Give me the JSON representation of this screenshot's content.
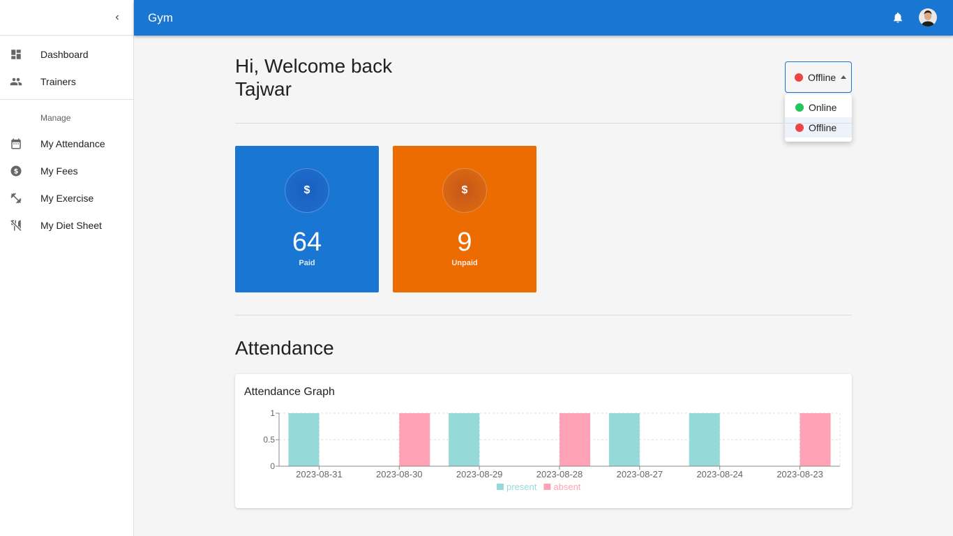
{
  "app": {
    "title": "Gym"
  },
  "sidebar": {
    "items": [
      {
        "label": "Dashboard",
        "icon": "dashboard-icon"
      },
      {
        "label": "Trainers",
        "icon": "people-icon"
      }
    ],
    "subheader": "Manage",
    "manage_items": [
      {
        "label": "My Attendance",
        "icon": "calendar-icon"
      },
      {
        "label": "My Fees",
        "icon": "dollar-circle-icon"
      },
      {
        "label": "My Exercise",
        "icon": "fitness-icon"
      },
      {
        "label": "My Diet Sheet",
        "icon": "no-meals-icon"
      }
    ]
  },
  "greeting": {
    "line1": "Hi, Welcome back",
    "line2": "Tajwar"
  },
  "status": {
    "selected": "Offline",
    "options": [
      {
        "label": "Online",
        "color": "#22c55e"
      },
      {
        "label": "Offline",
        "color": "#ef4444"
      }
    ]
  },
  "stats": {
    "paid": {
      "value": "64",
      "label": "Paid",
      "symbol": "$",
      "color": "#1976d2"
    },
    "unpaid": {
      "value": "9",
      "label": "Unpaid",
      "symbol": "$",
      "color": "#ed6c02"
    }
  },
  "attendance": {
    "section_title": "Attendance",
    "card_title": "Attendance Graph"
  },
  "chart_data": {
    "type": "bar",
    "categories": [
      "2023-08-31",
      "2023-08-30",
      "2023-08-29",
      "2023-08-28",
      "2023-08-27",
      "2023-08-24",
      "2023-08-23"
    ],
    "series": [
      {
        "name": "present",
        "values": [
          1,
          0,
          1,
          0,
          1,
          1,
          0
        ],
        "color": "#96d9d9"
      },
      {
        "name": "absent",
        "values": [
          0,
          1,
          0,
          1,
          0,
          0,
          1
        ],
        "color": "#ffa2b5"
      }
    ],
    "yticks": [
      "0",
      "0.5",
      "1"
    ],
    "ylim": [
      0,
      1
    ],
    "grid": true,
    "legend": "bottom"
  }
}
